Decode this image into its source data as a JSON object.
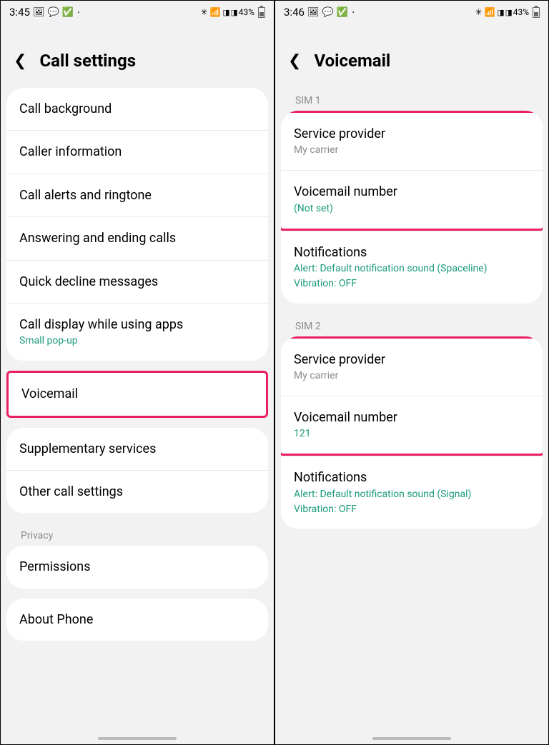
{
  "left": {
    "status": {
      "time": "3:45",
      "battery": "43%"
    },
    "header": {
      "title": "Call settings"
    },
    "card1": [
      {
        "title": "Call background"
      },
      {
        "title": "Caller information"
      },
      {
        "title": "Call alerts and ringtone"
      },
      {
        "title": "Answering and ending calls"
      },
      {
        "title": "Quick decline messages"
      },
      {
        "title": "Call display while using apps",
        "sub": "Small pop-up",
        "subClass": "teal"
      }
    ],
    "highlight": {
      "title": "Voicemail"
    },
    "card2": [
      {
        "title": "Supplementary services"
      },
      {
        "title": "Other call settings"
      }
    ],
    "privacy_label": "Privacy",
    "card3": [
      {
        "title": "Permissions"
      }
    ],
    "card4": [
      {
        "title": "About Phone"
      }
    ]
  },
  "right": {
    "status": {
      "time": "3:46",
      "battery": "43%"
    },
    "header": {
      "title": "Voicemail"
    },
    "sim1_label": "SIM 1",
    "sim1_hl": [
      {
        "title": "Service provider",
        "sub": "My carrier",
        "subClass": "gray"
      },
      {
        "title": "Voicemail number",
        "sub": "(Not set)",
        "subClass": "teal"
      }
    ],
    "sim1_notif": {
      "title": "Notifications",
      "sub1": "Alert: Default notification sound (Spaceline)",
      "sub2": "Vibration: OFF"
    },
    "sim2_label": "SIM 2",
    "sim2_hl": [
      {
        "title": "Service provider",
        "sub": "My carrier",
        "subClass": "gray"
      },
      {
        "title": "Voicemail number",
        "sub": "121",
        "subClass": "teal"
      }
    ],
    "sim2_notif": {
      "title": "Notifications",
      "sub1": "Alert: Default notification sound (Signal)",
      "sub2": "Vibration: OFF"
    }
  }
}
